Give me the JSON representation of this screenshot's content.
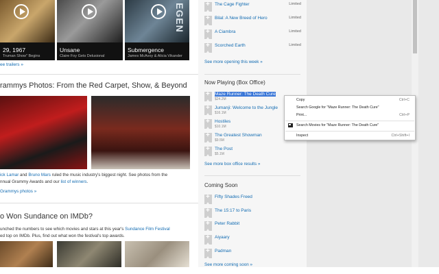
{
  "trailers": [
    {
      "title": "29, 1967",
      "subtitle": "Truman Show\" Begins"
    },
    {
      "title": "Unsane",
      "subtitle": "Claire Foy Gets Delusional"
    },
    {
      "title": "Submergence",
      "subtitle": "James McAvoy & Alicia Vikander"
    }
  ],
  "trailer_poster_text": "EGEN",
  "see_trailers": "ee trailers »",
  "grammys": {
    "heading": "rammys Photos: From the Red Carpet, Show, & Beyond",
    "line1_a": "ick Lamar",
    "line1_b": " and ",
    "line1_c": "Bruno Mars",
    "line1_d": " ruled the music industry's biggest night. See photos from the",
    "line2_a": "nnual Grammy Awards and our ",
    "line2_b": "list of winners",
    "line2_c": ".",
    "link": "Grammys photos »"
  },
  "sundance": {
    "heading": "o Won Sundance on IMDb?",
    "line1_a": "unched the numbers to see which movies and stars at this year's ",
    "line1_b": "Sundance Film Festival",
    "line2": "ed top on IMDb. Plus, find out what won the festival's top awards."
  },
  "sidebar": {
    "opening": [
      {
        "title": "The Cage Fighter",
        "right": "Limited"
      },
      {
        "title": "Bilal: A New Breed of Hero",
        "right": "Limited"
      },
      {
        "title": "A Ciambra",
        "right": "Limited"
      },
      {
        "title": "Scorched Earth",
        "right": "Limited"
      }
    ],
    "opening_more": "See more opening this week »",
    "box_office_heading": "Now Playing (Box Office)",
    "box_office": [
      {
        "title": "Maze Runner: The Death Cure",
        "gross": "$24.2M"
      },
      {
        "title": "Jumanji: Welcome to the Jungle",
        "gross": "$16.1M"
      },
      {
        "title": "Hostiles",
        "gross": "$10.1M"
      },
      {
        "title": "The Greatest Showman",
        "gross": "$9.5M"
      },
      {
        "title": "The Post",
        "gross": "$5.1M"
      }
    ],
    "box_office_more": "See more box office results »",
    "coming_heading": "Coming Soon",
    "coming": [
      {
        "title": "Fifty Shades Freed"
      },
      {
        "title": "The 15:17 to Paris"
      },
      {
        "title": "Peter Rabbit"
      },
      {
        "title": "Aiyaary"
      },
      {
        "title": "Padman"
      }
    ],
    "coming_more": "See more coming soon »"
  },
  "context_menu": {
    "copy": "Copy",
    "copy_short": "Ctrl+C",
    "search_google": "Search Google for \"Maze Runner: The Death Cure\"",
    "print": "Print...",
    "print_short": "Ctrl+P",
    "search_movies": "Search Movies for \"Maze Runner: The Death Cure\"",
    "inspect": "Inspect",
    "inspect_short": "Ctrl+Shift+I"
  }
}
